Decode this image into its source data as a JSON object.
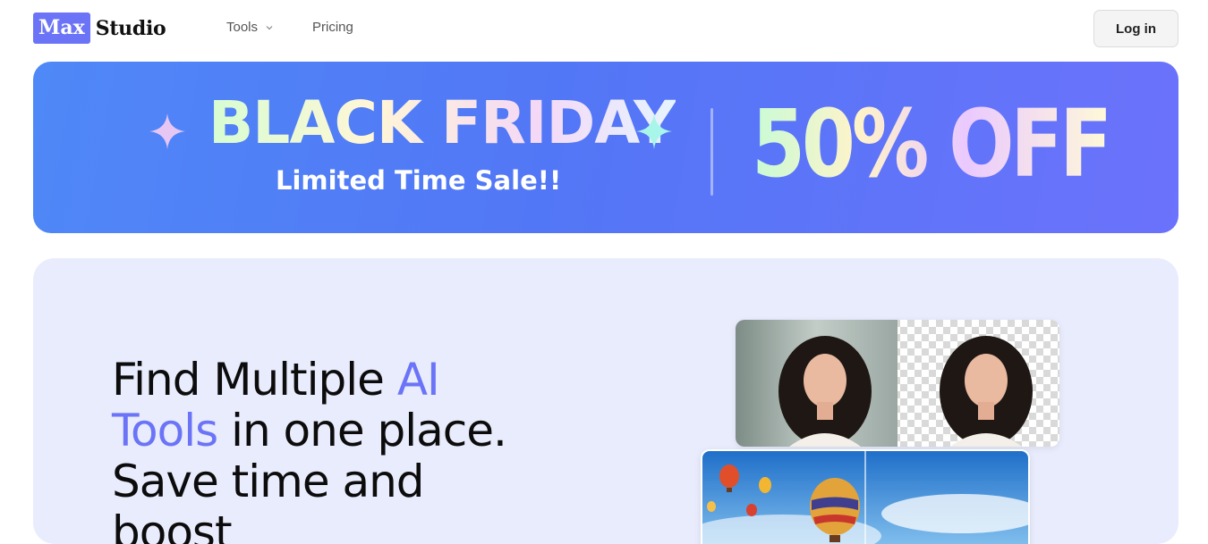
{
  "nav": {
    "logo_box": "Max",
    "logo_text": "Studio",
    "tools_label": "Tools",
    "pricing_label": "Pricing",
    "login_label": "Log in"
  },
  "banner": {
    "title": "BLACK FRIDAY",
    "subtitle": "Limited Time Sale!!",
    "offer": "50% OFF",
    "colors": {
      "background_start": "#4f88f7",
      "background_end": "#6b72fb",
      "sparkle_left": "#e7c6f4",
      "sparkle_right": "#a8f5e9"
    }
  },
  "hero": {
    "heading_part1": "Find Multiple ",
    "heading_accent1": "AI",
    "heading_accent2": "Tools",
    "heading_part2": " in one place.",
    "heading_line3": "Save time and",
    "heading_line4": "boost",
    "accent_color": "#6b74f7",
    "images": [
      {
        "name": "background-remover-example",
        "icon": "portrait-transparent-bg"
      },
      {
        "name": "sky-replacement-example",
        "icon": "hot-air-balloons"
      }
    ]
  }
}
